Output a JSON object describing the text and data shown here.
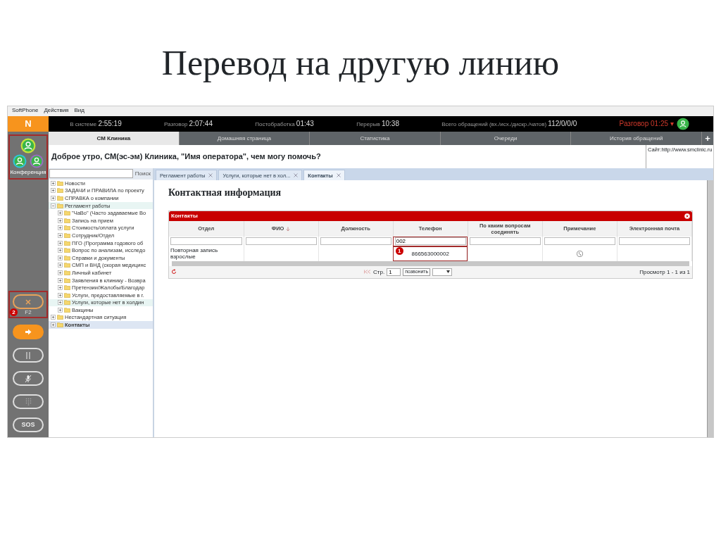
{
  "slide_title": "Перевод на другую линию",
  "menu": [
    "SoftPhone",
    "Действия",
    "Вид"
  ],
  "logo": "N",
  "status": [
    {
      "label": "В системе",
      "value": "2:55:19"
    },
    {
      "label": "Разговор",
      "value": "2:07:44"
    },
    {
      "label": "Постобработка",
      "value": "01:43"
    },
    {
      "label": "Перерыв",
      "value": "10:38"
    },
    {
      "label": "Всего обращений (вх./исх./дискр./чатов)",
      "value": "112/0/0/0"
    }
  ],
  "call_timer": {
    "label": "Разговор",
    "value": "01:25",
    "caret": "▾"
  },
  "tabs": [
    {
      "label": "СМ Клиника",
      "selected": true
    },
    {
      "label": "Домашняя страница",
      "selected": false
    },
    {
      "label": "Статистика",
      "selected": false
    },
    {
      "label": "Очереди",
      "selected": false
    },
    {
      "label": "История обращений",
      "selected": false
    }
  ],
  "add_tab": "+",
  "greeting": "Доброе утро, СМ(эс-эм) Клиника, \"Имя оператора\", чем могу помочь?",
  "site": {
    "label": "Сайт:",
    "link": "http://www.smclinic.ru"
  },
  "conference": {
    "label": "Конференция",
    "highlighted": true
  },
  "rail_buttons": [
    {
      "kind": "transfer",
      "label": "F2",
      "callout": "2"
    },
    {
      "kind": "forward"
    },
    {
      "kind": "hold"
    },
    {
      "kind": "mute"
    },
    {
      "kind": "dialpad"
    },
    {
      "kind": "sos",
      "text": "SOS"
    }
  ],
  "search_button": "Поиск",
  "tree": [
    {
      "label": "Новости",
      "expanded": false,
      "selected": false
    },
    {
      "label": "ЗАДАЧИ и ПРАВИЛА по проекту",
      "expanded": false,
      "selected": false
    },
    {
      "label": "СПРАВКА о компании",
      "expanded": false,
      "selected": false
    },
    {
      "label": "Регламент работы",
      "expanded": true,
      "selected": false,
      "highlighted": true,
      "children": [
        {
          "label": "\"ЧаВо\" (Часто задаваемые Во",
          "expanded": false,
          "selected": false
        },
        {
          "label": "Запись на прием",
          "expanded": false,
          "selected": false
        },
        {
          "label": "Стоимость/оплата услуги",
          "expanded": false,
          "selected": false
        },
        {
          "label": "Сотрудник/Отдел",
          "expanded": false,
          "selected": false
        },
        {
          "label": "ПГО (Программа годового об",
          "expanded": false,
          "selected": false
        },
        {
          "label": "Вопрос по анализам, исследо",
          "expanded": false,
          "selected": false
        },
        {
          "label": "Справки и документы",
          "expanded": false,
          "selected": false
        },
        {
          "label": "СМП и ВНД (скорая медицинс",
          "expanded": false,
          "selected": false
        },
        {
          "label": "Личный кабинет",
          "expanded": false,
          "selected": false
        },
        {
          "label": "Заявления в клинику - Возвра",
          "expanded": false,
          "selected": false
        },
        {
          "label": "Претензии/Жалобы/Благодар",
          "expanded": false,
          "selected": false
        },
        {
          "label": "Услуги, предоставляемые в г.",
          "expanded": false,
          "selected": false
        },
        {
          "label": "Услуги, которые нет в холдин",
          "expanded": false,
          "selected": false,
          "highlighted": true
        },
        {
          "label": "Вакцины",
          "expanded": false,
          "selected": false
        }
      ]
    },
    {
      "label": "Нестандартная ситуация",
      "expanded": false,
      "selected": false
    },
    {
      "label": "Контакты",
      "expanded": false,
      "selected": true
    }
  ],
  "content_tabs": [
    {
      "label": "Регламент работы",
      "selected": false
    },
    {
      "label": "Услуги, которые нет в хол...",
      "selected": false
    },
    {
      "label": "Контакты",
      "selected": true
    }
  ],
  "heading": "Контактная информация",
  "grid": {
    "title": "Контакты",
    "columns": [
      {
        "label": "Отдел"
      },
      {
        "label": "ФИО",
        "sorted": true
      },
      {
        "label": "Должность"
      },
      {
        "label": "Телефон",
        "callout": "1",
        "filter": "002"
      },
      {
        "label": "По каким вопросам соединять"
      },
      {
        "label": "Примечание"
      },
      {
        "label": "Электронная почта"
      }
    ],
    "rows": [
      {
        "cells": [
          "Повторная запись взрослые",
          null,
          null,
          "866563000002",
          null,
          null,
          null
        ]
      }
    ],
    "call_tooltip": "позвонить",
    "page_label": "Стр.",
    "page": "1",
    "summary": "Просмотр 1 - 1 из 1"
  }
}
